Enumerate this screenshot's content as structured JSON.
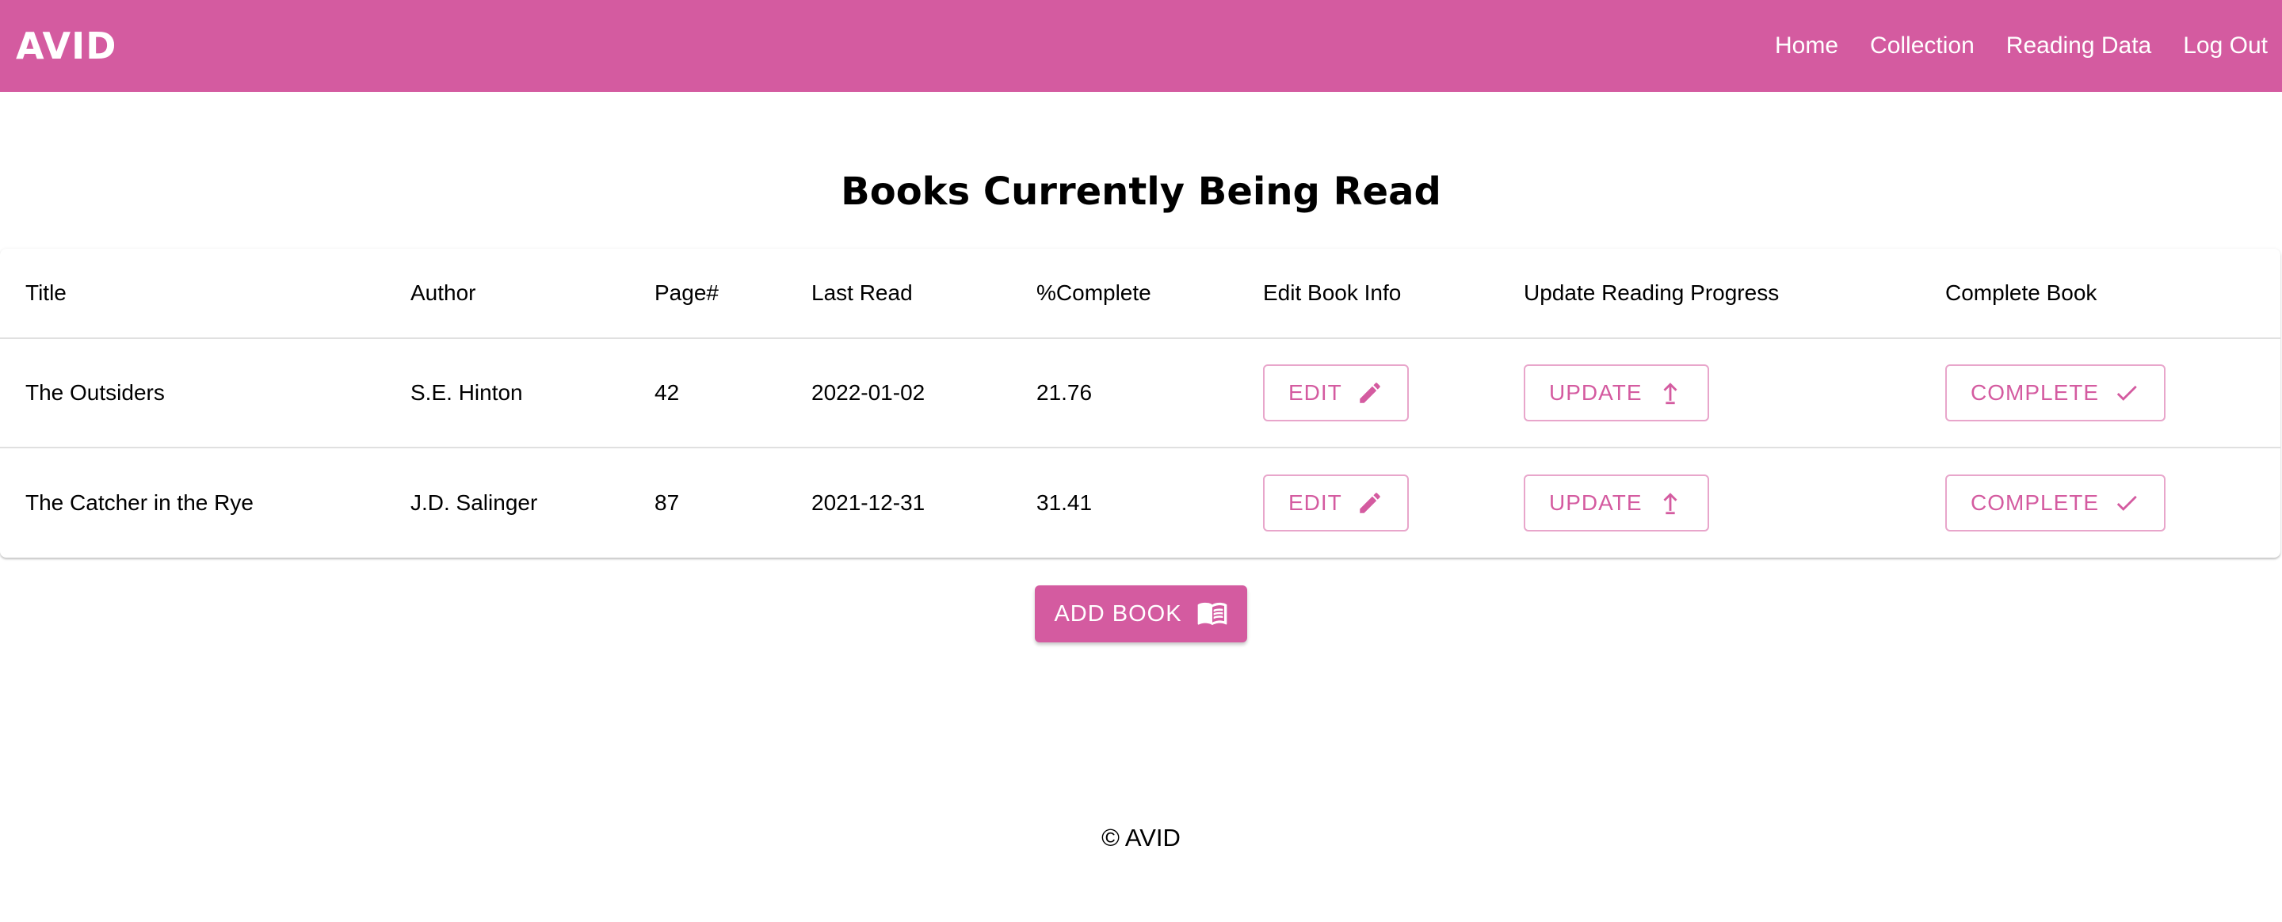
{
  "app": {
    "brand": "AVID",
    "accent_color": "#d45ba0"
  },
  "nav": {
    "items": [
      {
        "label": "Home"
      },
      {
        "label": "Collection"
      },
      {
        "label": "Reading Data"
      },
      {
        "label": "Log Out"
      }
    ]
  },
  "page": {
    "title": "Books Currently Being Read"
  },
  "table": {
    "headers": [
      "Title",
      "Author",
      "Page#",
      "Last Read",
      "%Complete",
      "Edit Book Info",
      "Update Reading Progress",
      "Complete Book"
    ],
    "rows": [
      {
        "title": "The Outsiders",
        "author": "S.E. Hinton",
        "page": "42",
        "last_read": "2022-01-02",
        "percent_complete": "21.76",
        "edit_label": "EDIT",
        "update_label": "UPDATE",
        "complete_label": "COMPLETE"
      },
      {
        "title": "The Catcher in the Rye",
        "author": "J.D. Salinger",
        "page": "87",
        "last_read": "2021-12-31",
        "percent_complete": "31.41",
        "edit_label": "EDIT",
        "update_label": "UPDATE",
        "complete_label": "COMPLETE"
      }
    ],
    "icons": {
      "edit": "pencil-icon",
      "update": "arrow-up-icon",
      "complete": "checkmark-icon"
    }
  },
  "add_book": {
    "label": "ADD BOOK",
    "icon": "book-icon"
  },
  "footer": {
    "text": "© AVID"
  }
}
